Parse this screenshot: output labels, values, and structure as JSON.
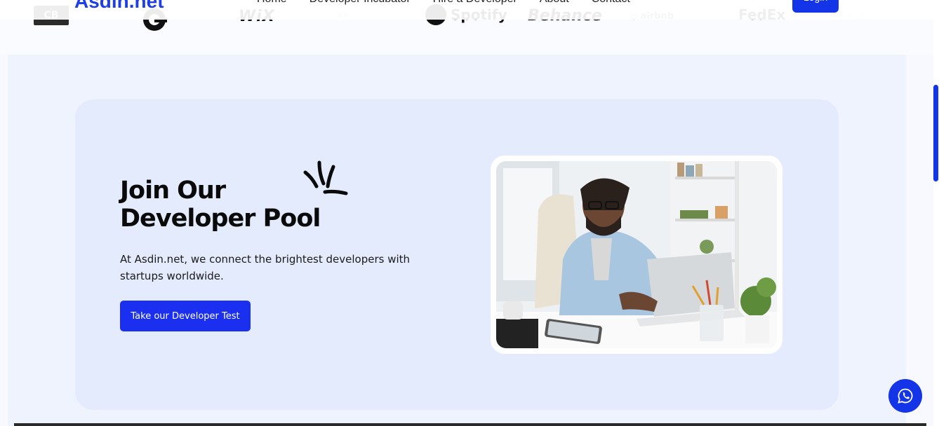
{
  "header": {
    "brand": "Asdin.net",
    "nav": [
      "Home",
      "Developer Incubator",
      "Hire a Developer",
      "About",
      "Contact"
    ],
    "login_label": "Login"
  },
  "logo_strip": {
    "logos": [
      "cb-logo",
      "g-logo",
      "wix",
      "logo",
      "spotify",
      "Behance",
      "airbnb",
      "FedEx",
      "logo"
    ]
  },
  "hero": {
    "title_line1": "Join Our",
    "title_line2": "Developer Pool",
    "description": "At Asdin.net, we connect the brightest developers with startups worldwide.",
    "cta_label": "Take our Developer Test",
    "image_alt": "Developer working on a laptop at a desk"
  },
  "colors": {
    "accent": "#1434e8",
    "section_bg": "#eff3fe",
    "card_bg": "#e4ebfd"
  },
  "icons": {
    "spark": "sparkle-icon",
    "chat": "whatsapp-icon"
  }
}
